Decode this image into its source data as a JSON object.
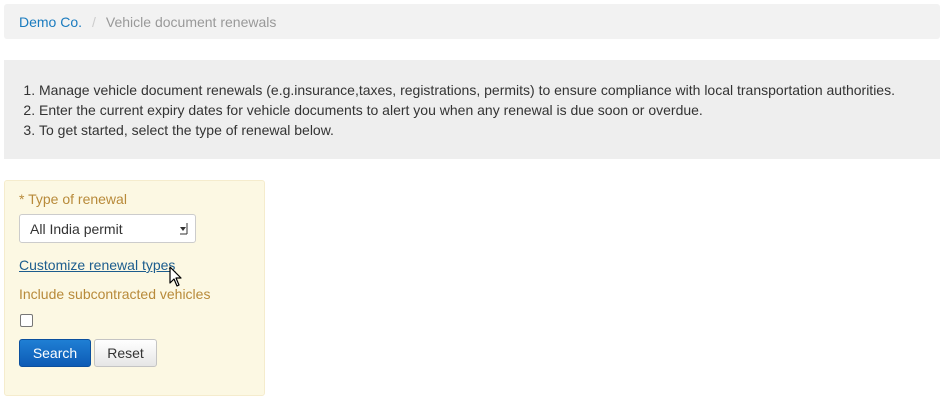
{
  "breadcrumb": {
    "home": "Demo Co.",
    "separator": "/",
    "current": "Vehicle document renewals"
  },
  "instructions": [
    "Manage vehicle document renewals (e.g.insurance,taxes, registrations, permits) to ensure compliance with local transportation authorities.",
    "Enter the current expiry dates for vehicle documents to alert you when any renewal is due soon or overdue.",
    "To get started, select the type of renewal below."
  ],
  "form": {
    "required_marker": "*",
    "type_label": "Type of renewal",
    "type_selected": "All India permit",
    "customize_link": "Customize renewal types",
    "subcontracted_label": "Include subcontracted vehicles",
    "subcontracted_checked": false,
    "search_button": "Search",
    "reset_button": "Reset"
  },
  "colors": {
    "link": "#1a7bbf",
    "label": "#b88a3a",
    "panel_bg": "#fcf8e3",
    "primary_button": "#1565c0"
  },
  "icons": {
    "select_arrow": "dropdown-arrow-icon",
    "cursor": "mouse-pointer-icon"
  }
}
